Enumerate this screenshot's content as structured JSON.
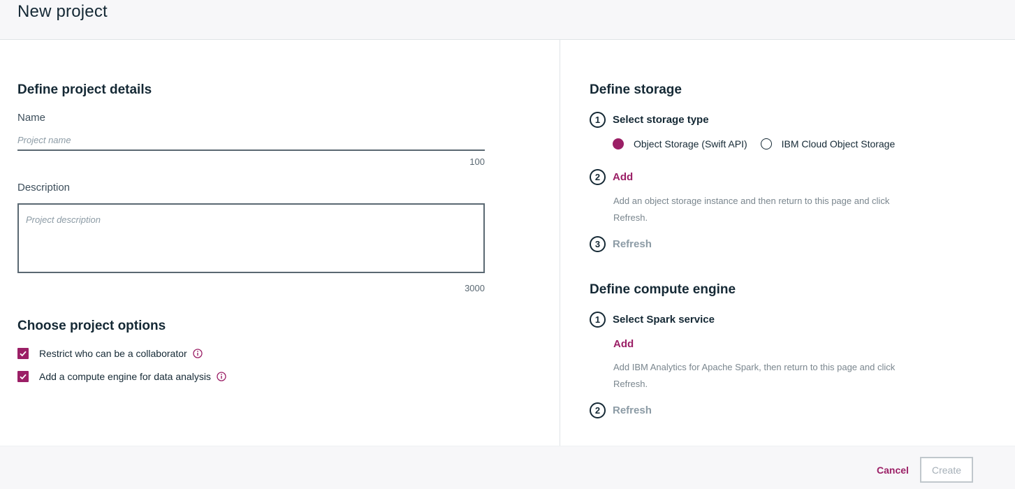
{
  "header": {
    "title": "New project"
  },
  "details": {
    "section_title": "Define project details",
    "name_label": "Name",
    "name_placeholder": "Project name",
    "name_value": "",
    "name_max": "100",
    "description_label": "Description",
    "description_placeholder": "Project description",
    "description_value": "",
    "description_max": "3000"
  },
  "options": {
    "section_title": "Choose project options",
    "items": [
      {
        "label": "Restrict who can be a collaborator",
        "checked": true,
        "icon": "info-icon"
      },
      {
        "label": "Add a compute engine for data analysis",
        "checked": true,
        "icon": "info-icon"
      }
    ]
  },
  "storage": {
    "section_title": "Define storage",
    "steps": [
      {
        "number": "1",
        "label": "Select storage type"
      },
      {
        "number": "2",
        "label": "Add"
      },
      {
        "number": "3",
        "label": "Refresh"
      }
    ],
    "radio_options": [
      {
        "label": "Object Storage (Swift API)",
        "selected": true
      },
      {
        "label": "IBM Cloud Object Storage",
        "selected": false
      }
    ],
    "add_help": "Add an object storage instance and then return to this page and click Refresh."
  },
  "compute": {
    "section_title": "Define compute engine",
    "steps": [
      {
        "number": "1",
        "label": "Select Spark service"
      },
      {
        "number": "2",
        "label": "Refresh"
      }
    ],
    "add_label": "Add",
    "add_help": "Add IBM Analytics for Apache Spark, then return to this page and click Refresh."
  },
  "footer": {
    "cancel_label": "Cancel",
    "create_label": "Create"
  },
  "colors": {
    "accent": "#9b1f66",
    "text": "#152935",
    "muted": "#8c9ba5",
    "border": "#5a6872"
  }
}
